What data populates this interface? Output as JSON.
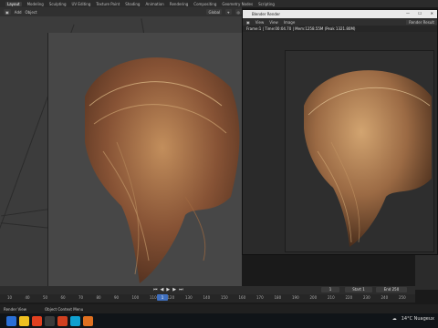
{
  "menu": {
    "workspaces": [
      "Layout",
      "Modeling",
      "Sculpting",
      "UV Editing",
      "Texture Paint",
      "Shading",
      "Animation",
      "Rendering",
      "Compositing",
      "Geometry Nodes",
      "Scripting"
    ],
    "active": "Layout"
  },
  "viewport_header": {
    "add": "Add",
    "object": "Object",
    "orientation": "Global"
  },
  "render_window": {
    "title": "Blender Render",
    "menu": [
      "View",
      "View",
      "Image"
    ],
    "slot": "Render Result",
    "stats": "Frame:1 | Time:00:04.70 | Mem:1258.55M (Peak 1321.80M)"
  },
  "timeline": {
    "ticks": [
      "10",
      "40",
      "50",
      "60",
      "70",
      "80",
      "90",
      "100",
      "110",
      "120",
      "130",
      "140",
      "150",
      "160",
      "170",
      "180",
      "190",
      "200",
      "210",
      "220",
      "230",
      "240",
      "250"
    ],
    "current_frame": "1",
    "start_label": "Start",
    "start_value": "1",
    "end_label": "End",
    "end_value": "250"
  },
  "status": {
    "left": "Render View",
    "mid": "Object Context Menu"
  },
  "taskbar": {
    "weather": "14°C  Nuageux",
    "colors": [
      "#2a6fd6",
      "#f0c020",
      "#e04020",
      "#3a3a3a",
      "#d04020",
      "#0fa0d0",
      "#e07020"
    ]
  }
}
